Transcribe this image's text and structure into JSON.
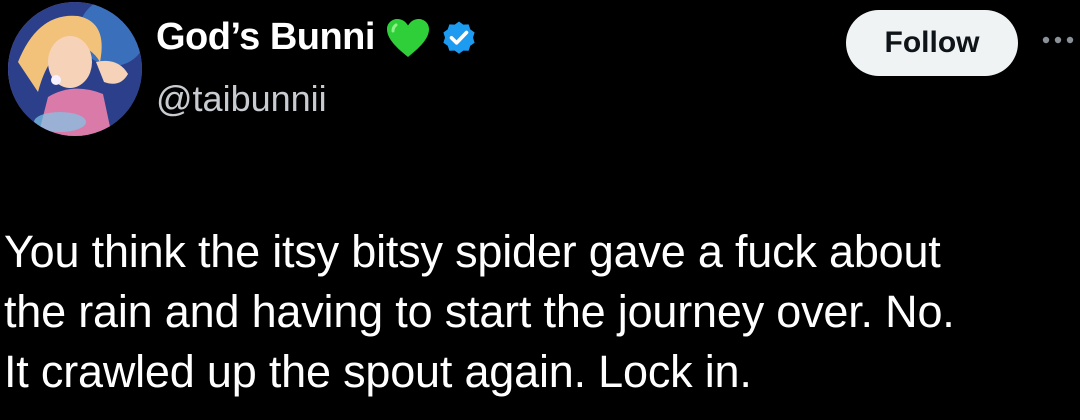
{
  "author": {
    "display_name": "God’s Bunni",
    "handle": "@taibunnii",
    "avatar_icon": "profile-avatar",
    "badges": [
      "green-heart-icon",
      "verified-badge-icon"
    ],
    "heart_color": "#2fcf3a",
    "verified_color": "#1d9bf0"
  },
  "actions": {
    "follow_label": "Follow",
    "more_icon": "more-options-icon"
  },
  "tweet": {
    "lines": [
      "You think the itsy bitsy spider gave a fuck about",
      "the rain and having to start the journey over. No.",
      "It crawled up the spout again. Lock in."
    ]
  },
  "colors": {
    "background": "#000000",
    "text": "#ffffff",
    "secondary_text": "#c8ccd1",
    "button_bg": "#eff3f4",
    "button_text": "#0f1419"
  }
}
